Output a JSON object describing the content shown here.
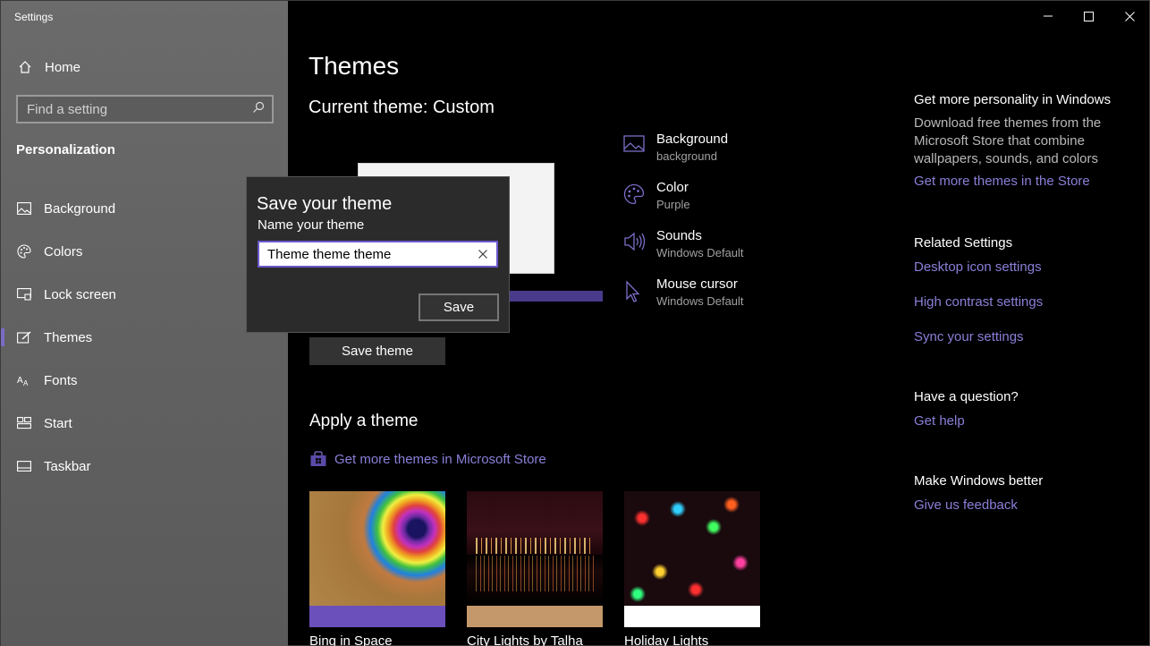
{
  "window": {
    "title": "Settings",
    "controls": [
      "minimize",
      "maximize",
      "close"
    ]
  },
  "sidebar": {
    "home_label": "Home",
    "search_placeholder": "Find a setting",
    "section": "Personalization",
    "items": [
      {
        "label": "Background",
        "icon": "image-icon",
        "active": false
      },
      {
        "label": "Colors",
        "icon": "palette-icon",
        "active": false
      },
      {
        "label": "Lock screen",
        "icon": "lock-screen-icon",
        "active": false
      },
      {
        "label": "Themes",
        "icon": "themes-brush-icon",
        "active": true
      },
      {
        "label": "Fonts",
        "icon": "fonts-icon",
        "active": false
      },
      {
        "label": "Start",
        "icon": "start-grid-icon",
        "active": false
      },
      {
        "label": "Taskbar",
        "icon": "taskbar-icon",
        "active": false
      }
    ]
  },
  "main": {
    "title": "Themes",
    "current_theme": "Current theme: Custom",
    "save_theme_label": "Save theme",
    "properties": [
      {
        "title": "Background",
        "value": "background",
        "icon": "image-icon"
      },
      {
        "title": "Color",
        "value": "Purple",
        "icon": "palette-icon"
      },
      {
        "title": "Sounds",
        "value": "Windows Default",
        "icon": "speaker-icon"
      },
      {
        "title": "Mouse cursor",
        "value": "Windows Default",
        "icon": "cursor-icon"
      }
    ],
    "apply_heading": "Apply a theme",
    "store_link": "Get more themes in Microsoft Store",
    "themes": [
      {
        "name": "Bing in Space",
        "accent": "#6b4fbb"
      },
      {
        "name": "City Lights by Talha",
        "accent": "#c4986a"
      },
      {
        "name": "Holiday Lights",
        "accent": "#ffffff"
      }
    ]
  },
  "right": {
    "personality_heading": "Get more personality in Windows",
    "personality_desc": "Download free themes from the Microsoft Store that combine wallpapers, sounds, and colors",
    "personality_link": "Get more themes in the Store",
    "related_heading": "Related Settings",
    "related_links": [
      "Desktop icon settings",
      "High contrast settings",
      "Sync your settings"
    ],
    "question_heading": "Have a question?",
    "question_link": "Get help",
    "better_heading": "Make Windows better",
    "better_link": "Give us feedback"
  },
  "dialog": {
    "title": "Save your theme",
    "label": "Name your theme",
    "value": "Theme theme theme",
    "save_label": "Save"
  },
  "colors": {
    "accent": "#6b4fbb",
    "link": "#8a7fd8"
  }
}
